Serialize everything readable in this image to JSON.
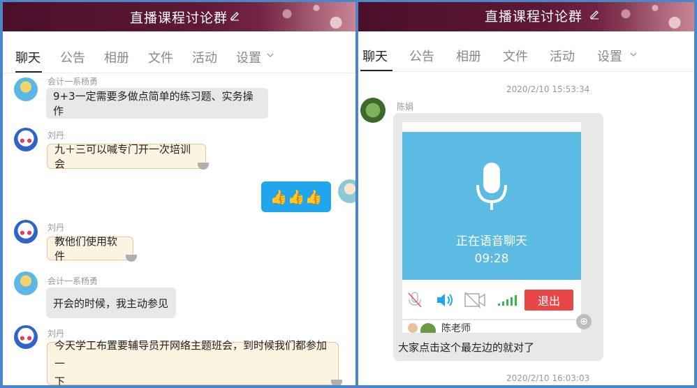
{
  "left": {
    "title": "直播课程讨论群",
    "tabs": [
      "聊天",
      "公告",
      "相册",
      "文件",
      "活动",
      "设置"
    ],
    "messages": [
      {
        "name": "会计一系杨勇",
        "text": "9+3一定需要多做点简单的练习题、实务操作"
      },
      {
        "name": "刘丹",
        "text": "九＋三可以喊专门开一次培训会"
      },
      {
        "name": "",
        "text": "👍👍👍"
      },
      {
        "name": "刘丹",
        "text": "教他们使用软件"
      },
      {
        "name": "会计一系杨勇",
        "text": "开会的时候，我主动参见"
      },
      {
        "name": "刘丹",
        "text_line1": "今天学工布置要辅导员开网络主题班会，到时候我们都参加一",
        "text_line2": "下"
      }
    ]
  },
  "right": {
    "title": "直播课程讨论群",
    "tabs": [
      "聊天",
      "公告",
      "相册",
      "文件",
      "活动",
      "设置"
    ],
    "time1": "2020/2/10 15:53:34",
    "sender": "陈娟",
    "voice_status": "正在语音聊天",
    "voice_timer": "09:28",
    "exit_label": "退出",
    "participant": "陈老师",
    "caption": "大家点击这个最左边的就对了",
    "time2": "2020/2/10 16:03:03"
  },
  "icons": [
    "edit-icon",
    "chevron-down-icon",
    "mic-icon",
    "mute-icon",
    "speaker-icon",
    "camera-off-icon",
    "signal-icon",
    "zoom-icon",
    "thumbs-up-icon"
  ],
  "colors": {
    "banner": "#5e1834",
    "bubble_blue": "#1fa6ec",
    "voice_bg": "#5bbbe2",
    "exit": "#e8474a"
  }
}
